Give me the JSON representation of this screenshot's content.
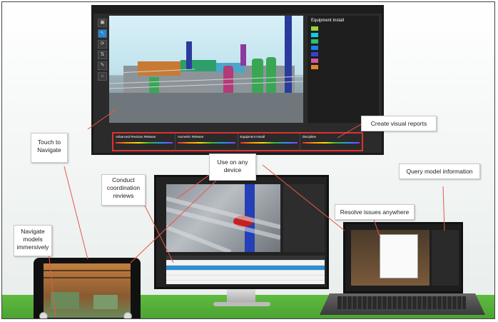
{
  "callouts": {
    "touch": "Touch to\nNavigate",
    "use_any": "Use on any\ndevice",
    "create_reports": "Create visual reports",
    "conduct": "Conduct\ncoordination\nreviews",
    "query": "Query model information",
    "resolve": "Resolve issues anywhere",
    "navigate": "Navigate\nmodels\nimmersively"
  },
  "wall": {
    "panel_title": "Equipment Install",
    "panel_legend": [
      {
        "color": "#9bd23a"
      },
      {
        "color": "#18c8e8"
      },
      {
        "color": "#29c36a"
      },
      {
        "color": "#1e7de6"
      },
      {
        "color": "#3344cc"
      },
      {
        "color": "#d05a9a"
      },
      {
        "color": "#e0872a"
      }
    ],
    "status": [
      {
        "label": "Advanced Revision Release"
      },
      {
        "label": "Isometric Release"
      },
      {
        "label": "Equipment Install"
      },
      {
        "label": "Discipline"
      }
    ]
  }
}
